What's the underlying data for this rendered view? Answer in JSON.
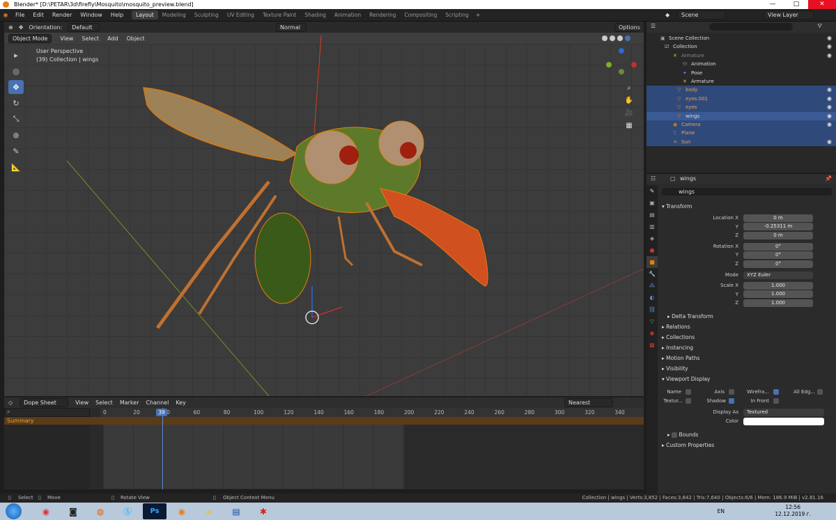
{
  "window": {
    "title": "Blender* [D:\\PETAR\\3d\\firefly\\Mosquito\\mosquito_preview.blend]",
    "min": "—",
    "max": "□",
    "close": "✕"
  },
  "topbar": {
    "menus": [
      "File",
      "Edit",
      "Render",
      "Window",
      "Help"
    ],
    "workspaces": [
      "Layout",
      "Modeling",
      "Sculpting",
      "UV Editing",
      "Texture Paint",
      "Shading",
      "Animation",
      "Rendering",
      "Compositing",
      "Scripting"
    ],
    "active_workspace": "Layout",
    "scene": "Scene",
    "view_layer": "View Layer"
  },
  "viewport": {
    "mode": "Object Mode",
    "menus": [
      "View",
      "Select",
      "Add",
      "Object"
    ],
    "orientation_label": "Orientation:",
    "orientation_value": "Default",
    "pivot": "Normal",
    "options": "Options",
    "perspective": "User Perspective",
    "collection_info": "(39) Collection | wings",
    "tools": [
      "select-icon",
      "cursor-icon",
      "move-icon",
      "rotate-icon",
      "scale-icon",
      "transform-icon",
      "annotate-icon",
      "measure-icon"
    ]
  },
  "timeline": {
    "editor": "Dope Sheet",
    "menus": [
      "View",
      "Select",
      "Marker",
      "Channel",
      "Key"
    ],
    "snap": "Nearest Frame",
    "summary": "Summary",
    "current_frame": "39",
    "ticks": [
      "0",
      "20",
      "40",
      "60",
      "80",
      "100",
      "120",
      "140",
      "160",
      "180",
      "200",
      "220",
      "240",
      "260",
      "280",
      "300",
      "320",
      "340"
    ]
  },
  "outliner": {
    "rows": [
      {
        "label": "Scene Collection",
        "state": "normal"
      },
      {
        "label": "Collection",
        "state": "normal"
      },
      {
        "label": "Armature",
        "state": "dim"
      },
      {
        "label": "Animation",
        "state": "normal"
      },
      {
        "label": "Pose",
        "state": "normal"
      },
      {
        "label": "Armature",
        "state": "normal"
      },
      {
        "label": "body",
        "state": "sel"
      },
      {
        "label": "eyes.001",
        "state": "sel"
      },
      {
        "label": "eyes",
        "state": "sel"
      },
      {
        "label": "wings",
        "state": "active"
      },
      {
        "label": "Camera",
        "state": "sel"
      },
      {
        "label": "Plane",
        "state": "sel"
      },
      {
        "label": "Sun",
        "state": "sel"
      }
    ]
  },
  "properties": {
    "object_name": "wings",
    "data_name": "wings",
    "transform_label": "Transform",
    "location": {
      "label_x": "Location X",
      "x": "0 m",
      "y": "-0.25311 m",
      "z": "0 m"
    },
    "rotation": {
      "label_x": "Rotation X",
      "x": "0°",
      "y": "0°",
      "z": "0°"
    },
    "mode_label": "Mode",
    "mode_value": "XYZ Euler",
    "scale": {
      "label_x": "Scale X",
      "x": "1.000",
      "y": "1.000",
      "z": "1.000"
    },
    "axis_y": "Y",
    "axis_z": "Z",
    "delta_transform": "Delta Transform",
    "sections": [
      "Relations",
      "Collections",
      "Instancing",
      "Motion Paths",
      "Visibility"
    ],
    "viewport_display": "Viewport Display",
    "vd": {
      "name": "Name",
      "axis": "Axis",
      "wireframe": "Wirefra...",
      "all_edges": "All Edg...",
      "texture": "Textur...",
      "shadow": "Shadow",
      "in_front": "In Front",
      "display_as_label": "Display As",
      "display_as_value": "Textured",
      "color_label": "Color",
      "bounds": "Bounds"
    },
    "custom_props": "Custom Properties"
  },
  "statusbar": {
    "select": "Select",
    "move": "Move",
    "rotate_view": "Rotate View",
    "context_menu": "Object Context Menu",
    "stats": "Collection | wings | Verts:3,852 | Faces:3,842 | Tris:7,640 | Objects:6/6 | Mem: 186.9 MiB | v2.81.16"
  },
  "taskbar": {
    "lang": "EN",
    "time": "12:56",
    "date": "12.12.2019 г.",
    "apps": [
      "windows-start-icon",
      "chrome-icon",
      "app-icon",
      "firefox-icon",
      "skype-icon",
      "photoshop-icon",
      "blender-icon",
      "folder-icon",
      "notes-icon",
      "paint-icon"
    ]
  },
  "colors": {
    "accent": "#4772b3",
    "selected_orange": "#e87d0d",
    "panel": "#2b2b2b"
  }
}
